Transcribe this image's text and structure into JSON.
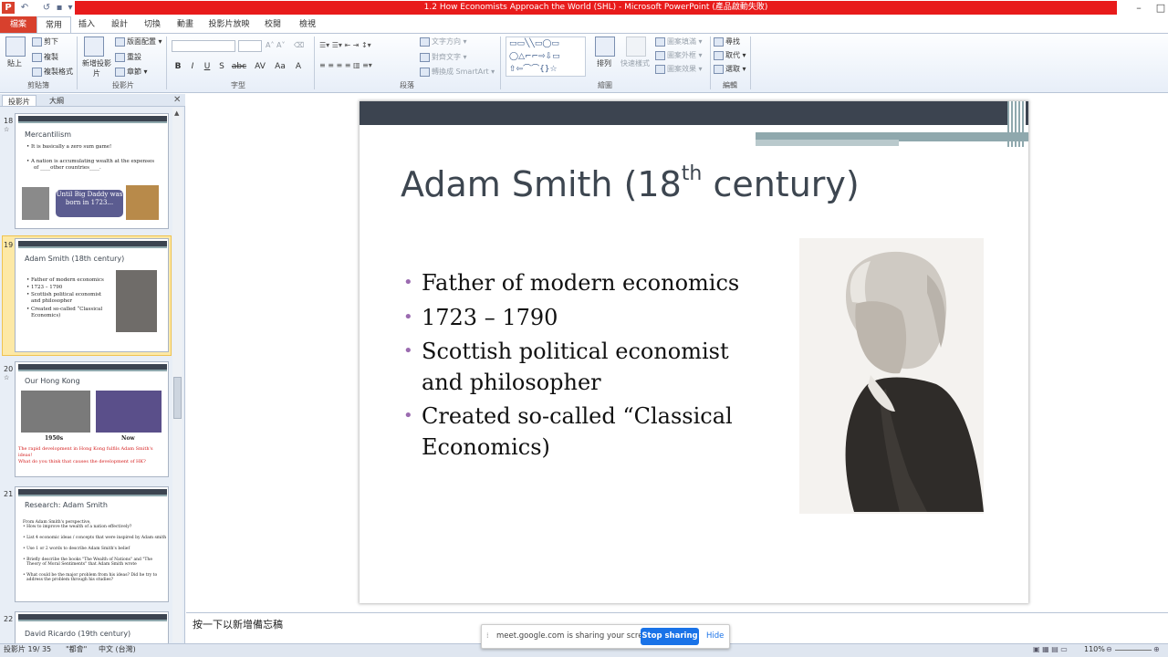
{
  "window": {
    "title": "1.2 How Economists Approach the World (SHL) - Microsoft PowerPoint (產品啟動失敗)"
  },
  "tabs": [
    {
      "label": "檔案"
    },
    {
      "label": "常用"
    },
    {
      "label": "插入"
    },
    {
      "label": "設計"
    },
    {
      "label": "切換"
    },
    {
      "label": "動畫"
    },
    {
      "label": "投影片放映"
    },
    {
      "label": "校閱"
    },
    {
      "label": "檢視"
    }
  ],
  "ribbon": {
    "clipboard": {
      "paste": "貼上",
      "cut": "剪下",
      "copy": "複製",
      "format_painter": "複製格式",
      "label": "剪貼簿"
    },
    "slides": {
      "new_slide": "新增投影片",
      "layout": "版面配置",
      "reset": "重設",
      "section": "章節",
      "label": "投影片"
    },
    "font": {
      "label": "字型",
      "bold": "B",
      "italic": "I",
      "underline": "U",
      "strike": "S",
      "abc": "abc",
      "spacing": "AV",
      "case": "Aa",
      "color": "A"
    },
    "paragraph": {
      "text_direction": "文字方向",
      "align_text": "對齊文字",
      "smartart": "轉換成 SmartArt",
      "label": "段落"
    },
    "drawing": {
      "arrange": "排列",
      "quick_styles": "快速樣式",
      "shape_fill": "圖案填滿",
      "shape_outline": "圖案外框",
      "shape_effects": "圖案效果",
      "label": "繪圖"
    },
    "editing": {
      "find": "尋找",
      "replace": "取代",
      "select": "選取",
      "label": "編輯"
    }
  },
  "left_pane": {
    "tab_slides": "投影片",
    "tab_outline": "大綱",
    "thumbs": [
      {
        "num": "18",
        "title": "Mercantilism",
        "lines": [
          "• It is basically a zero sum game!",
          "• A nation is accumulating wealth at the expenses",
          "of ____other countries____."
        ],
        "callout": "Until Big Daddy was born in 1723..."
      },
      {
        "num": "19",
        "title": "Adam Smith (18th century)",
        "lines": [
          "• Father of modern economics",
          "• 1723 – 1790",
          "• Scottish political economist",
          "and philosopher",
          "• Created so-called “Classical",
          "Economics)"
        ]
      },
      {
        "num": "20",
        "title": "Our Hong Kong",
        "cap1": "1950s",
        "cap2": "Now",
        "red1": "The rapid development in Hong Kong fulfils Adam Smith's ideas!",
        "red2": "What do you think that causes the development of HK?"
      },
      {
        "num": "21",
        "title": "Research: Adam Smith",
        "lines": [
          "From Adam Smith's perspective,",
          "• How to improve the wealth of a nation effectively?",
          "• List 4 economic ideas / concepts that were inspired by Adam smith",
          "• Use 1 or 2 words to describe Adam Smith's belief",
          "• Briefly describe the books \"The Wealth of Nations\" and \"The",
          "Theory of Moral Sentiments\" that Adam Smith wrote",
          "• What could be the major problem from his ideas? Did he try to",
          "address the problem through his studies?"
        ]
      },
      {
        "num": "22",
        "title": "David Ricardo (19th century)"
      }
    ]
  },
  "slide": {
    "title_main": "Adam Smith (18",
    "title_sup": "th",
    "title_end": " century)",
    "bullets": [
      "Father of modern economics",
      "1723 – 1790",
      "Scottish political economist and philosopher",
      "Created so-called “Classical Economics)"
    ]
  },
  "notes": {
    "placeholder": "按一下以新增備忘稿"
  },
  "status": {
    "slide_info": "投影片 19/ 35",
    "theme": "\"都會\"",
    "language": "中文 (台灣)",
    "zoom": "110%"
  },
  "share_banner": {
    "text": "meet.google.com is sharing your screen.",
    "stop": "Stop sharing",
    "hide": "Hide"
  },
  "colors": {
    "title_bar": "#e81b1b",
    "slide_band": "#3c4450",
    "slide_accent": "#8fa8ad",
    "bullet_dot": "#9b6bb0",
    "stop_button": "#1a73e8"
  }
}
